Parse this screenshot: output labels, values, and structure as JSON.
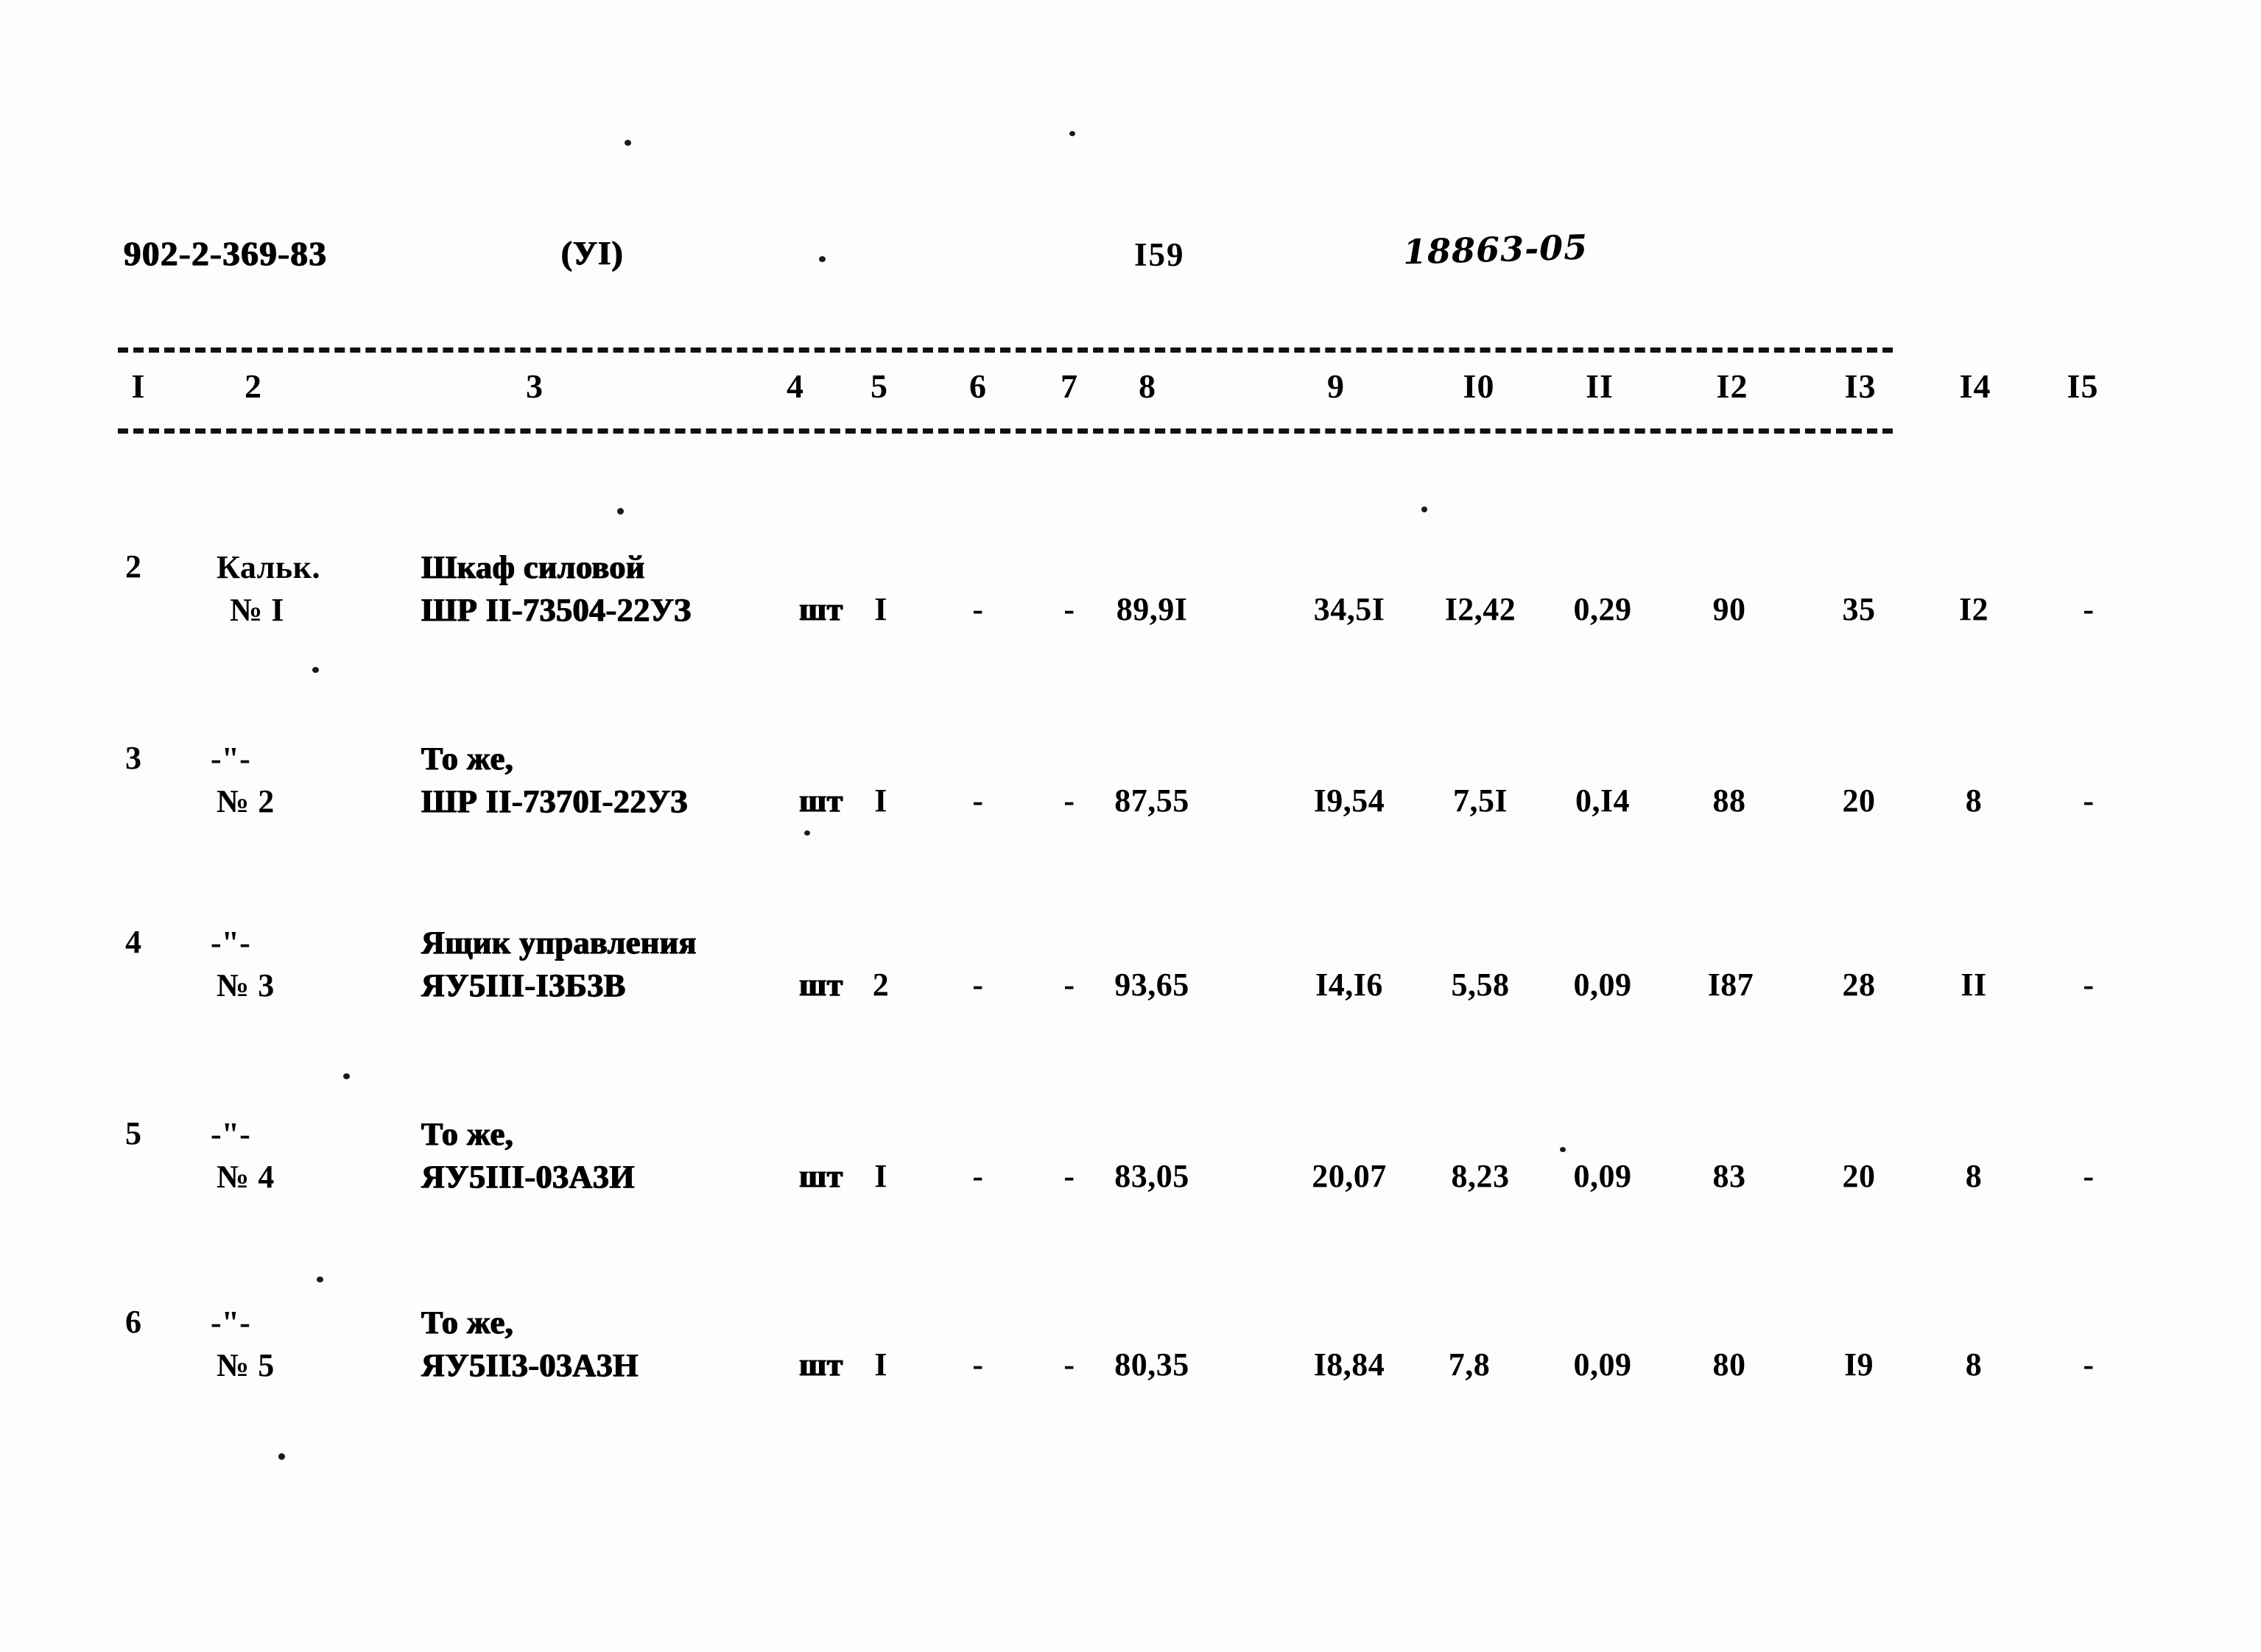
{
  "document": {
    "code": "902-2-369-83",
    "album": "(УI)",
    "page_number": "I59",
    "stamp": "18863-05"
  },
  "table": {
    "column_headers": [
      "I",
      "2",
      "3",
      "4",
      "5",
      "6",
      "7",
      "8",
      "9",
      "I0",
      "II",
      "I2",
      "I3",
      "I4",
      "I5"
    ],
    "rows": [
      {
        "c1": "2",
        "c2_line1": "Кальк.",
        "c2_line2": "№ I",
        "c3_line1": "Шкаф силовой",
        "c3_line2": "ШР II-73504-22УЗ",
        "c4": "шт",
        "c5": "I",
        "c6": "-",
        "c7": "-",
        "c8": "89,9I",
        "c9": "34,5I",
        "c10": "I2,42",
        "c11": "0,29",
        "c12": "90",
        "c13": "35",
        "c14": "I2",
        "c15": "-"
      },
      {
        "c1": "3",
        "c2_line1": "-\"-",
        "c2_line2": "№ 2",
        "c3_line1": "То же,",
        "c3_line2": "ШР II-7370I-22УЗ",
        "c4": "шт",
        "c5": "I",
        "c6": "-",
        "c7": "-",
        "c8": "87,55",
        "c9": "I9,54",
        "c10": "7,5I",
        "c11": "0,I4",
        "c12": "88",
        "c13": "20",
        "c14": "8",
        "c15": "-"
      },
      {
        "c1": "4",
        "c2_line1": "-\"-",
        "c2_line2": "№ 3",
        "c3_line1": "Ящик управления",
        "c3_line2": "ЯУ5III-I3Б3В",
        "c4": "шт",
        "c5": "2",
        "c6": "-",
        "c7": "-",
        "c8": "93,65",
        "c9": "I4,I6",
        "c10": "5,58",
        "c11": "0,09",
        "c12": "I87",
        "c13": "28",
        "c14": "II",
        "c15": "-"
      },
      {
        "c1": "5",
        "c2_line1": "-\"-",
        "c2_line2": "№ 4",
        "c3_line1": "То же,",
        "c3_line2": "ЯУ5III-03А3И",
        "c4": "шт",
        "c5": "I",
        "c6": "-",
        "c7": "-",
        "c8": "83,05",
        "c9": "20,07",
        "c10": "8,23",
        "c11": "0,09",
        "c12": "83",
        "c13": "20",
        "c14": "8",
        "c15": "-"
      },
      {
        "c1": "6",
        "c2_line1": "-\"-",
        "c2_line2": "№ 5",
        "c3_line1": "То же,",
        "c3_line2": "ЯУ5II3-03А3Н",
        "c4": "шт",
        "c5": "I",
        "c6": "-",
        "c7": "-",
        "c8": "80,35",
        "c9": "I8,84",
        "c10": "7,8",
        "c11": "0,09",
        "c12": "80",
        "c13": "I9",
        "c14": "8",
        "c15": "-"
      }
    ]
  }
}
